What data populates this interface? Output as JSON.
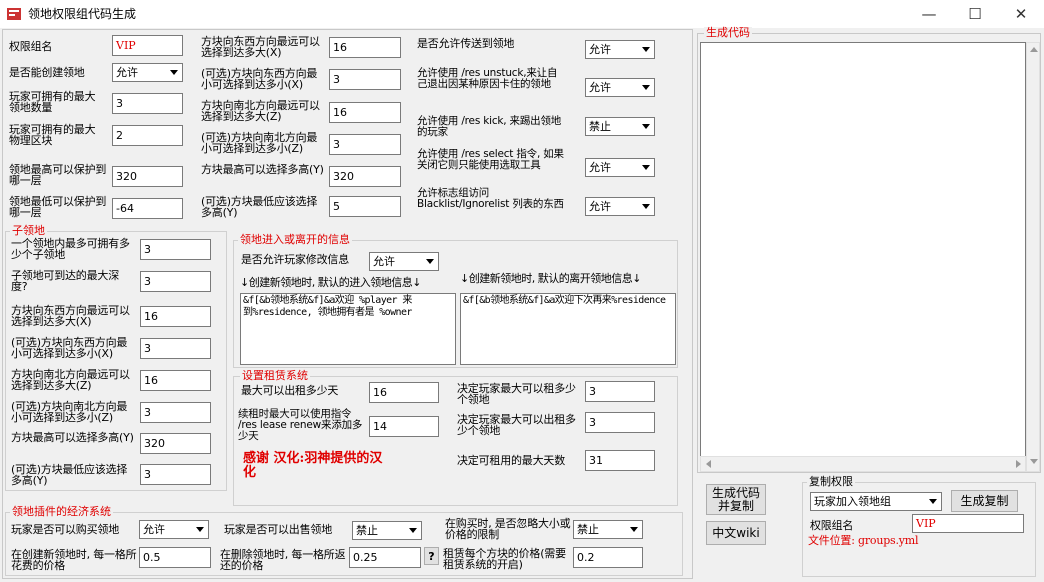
{
  "window": {
    "title": "领地权限组代码生成",
    "minimize": "—",
    "maximize": "☐",
    "close": "✕"
  },
  "colors": {
    "accent": "#e00000",
    "field_bg": "#ffffff",
    "window_bg": "#f0f0f0"
  },
  "general": {
    "perm_name_label": "权限组名",
    "perm_name_value": "VIP",
    "can_create_label": "是否能创建领地",
    "can_create_value": "允许",
    "max_res_label": "玩家可拥有的最大领地数量",
    "max_res_value": "3",
    "max_phys_label": "玩家可拥有的最大物理区块",
    "max_phys_value": "2",
    "max_y_label": "领地最高可以保护到哪一层",
    "max_y_value": "320",
    "min_y_label": "领地最低可以保护到哪一层",
    "min_y_value": "-64"
  },
  "size": {
    "ew_max_label": "方块向东西方向最远可以选择到达多大(X)",
    "ew_max_value": "16",
    "ew_min_label": "(可选)方块向东西方向最小可选择到达多小(X)",
    "ew_min_value": "3",
    "ns_max_label": "方块向南北方向最远可以选择到达多大(Z)",
    "ns_max_value": "16",
    "ns_min_label": "(可选)方块向南北方向最小可选择到达多小(Z)",
    "ns_min_value": "3",
    "y_max_label": "方块最高可以选择多高(Y)",
    "y_max_value": "320",
    "y_min_label": "(可选)方块最低应该选择多高(Y)",
    "y_min_value": "5"
  },
  "perms": {
    "tp_label": "是否允许传送到领地",
    "tp_value": "允许",
    "unstuck_label": "允许使用 /res unstuck,来让自己退出因某种原因卡住的领地",
    "unstuck_value": "允许",
    "kick_label": "允许使用 /res kick, 来踢出领地的玩家",
    "kick_value": "禁止",
    "select_label": "允许使用 /res select 指令, 如果关闭它则只能使用选取工具",
    "select_value": "允许",
    "blacklist_label": "允许标志组访问Blacklist/Ignorelist 列表的东西",
    "blacklist_value": "允许"
  },
  "subzone": {
    "title": "子领地",
    "max_count_label": "一个领地内最多可拥有多少个子领地",
    "max_count_value": "3",
    "depth_label": "子领地可到达的最大深度?",
    "depth_value": "3",
    "ew_max_label": "方块向东西方向最远可以选择到达多大(X)",
    "ew_max_value": "16",
    "ew_min_label": "(可选)方块向东西方向最小可选择到达多小(X)",
    "ew_min_value": "3",
    "ns_max_label": "方块向南北方向最远可以选择到达多大(Z)",
    "ns_max_value": "16",
    "ns_min_label": "(可选)方块向南北方向最小可选择到达多小(Z)",
    "ns_min_value": "3",
    "y_max_label": "方块最高可以选择多高(Y)",
    "y_max_value": "320",
    "y_min_label": "(可选)方块最低应该选择多高(Y)",
    "y_min_value": "3"
  },
  "messages": {
    "title": "领地进入或离开的信息",
    "allow_edit_label": "是否允许玩家修改信息",
    "allow_edit_value": "允许",
    "enter_label": "↓创建新领地时, 默认的进入领地信息↓",
    "leave_label": "↓创建新领地时, 默认的离开领地信息↓",
    "enter_text": "&f[&b领地系统&f]&a欢迎 %player 来到%residence, 领地拥有者是 %owner",
    "leave_text": "&f[&b领地系统&f]&a欢迎下次再来%residence"
  },
  "rent": {
    "title": "设置租赁系统",
    "max_days_label": "最大可以出租多少天",
    "max_days_value": "16",
    "renew_label": "续租时最大可以使用指令 /res lease renew来添加多少天",
    "renew_value": "14",
    "max_rent_label": "决定玩家最大可以租多少个领地",
    "max_rent_value": "3",
    "max_rentout_label": "决定玩家最大可以出租多少个领地",
    "max_rentout_value": "3",
    "max_rentable_days_label": "决定可租用的最大天数",
    "max_rentable_days_value": "31",
    "thanks_text": "感谢 汉化:羽神提供的汉化"
  },
  "economy": {
    "title": "领地插件的经济系统",
    "buy_label": "玩家是否可以购买领地",
    "buy_value": "允许",
    "sell_label": "玩家是否可以出售领地",
    "sell_value": "禁止",
    "ignore_limit_label": "在购买时, 是否忽略大小或价格的限制",
    "ignore_limit_value": "禁止",
    "create_cost_label": "在创建新领地时, 每一格所花费的价格",
    "create_cost_value": "0.5",
    "delete_refund_label": "在删除领地时, 每一格所返还的价格",
    "delete_refund_value": "0.25",
    "help_mark": "?",
    "rent_cost_label": "租赁每个方块的价格(需要租赁系统的开启)",
    "rent_cost_value": "0.2"
  },
  "code": {
    "title": "生成代码",
    "output": ""
  },
  "actions": {
    "generate_copy": "生成代码并复制",
    "chinese_wiki": "中文wiki"
  },
  "copy_perm": {
    "title": "复制权限",
    "type_value": "玩家加入领地组",
    "copy_button": "生成复制",
    "perm_name_label": "权限组名",
    "perm_name_value": "VIP",
    "file_location": "文件位置: groups.yml"
  }
}
